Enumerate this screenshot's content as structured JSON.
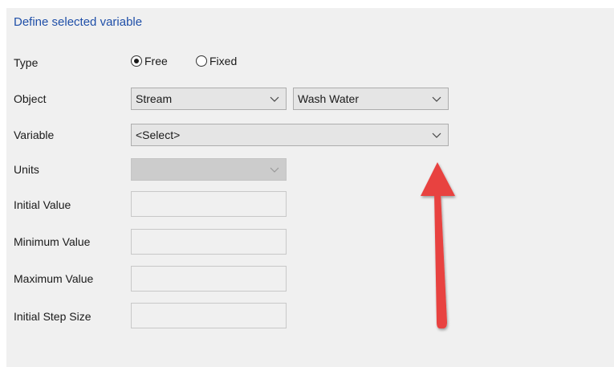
{
  "title": "Define selected variable",
  "rows": {
    "type": {
      "label": "Type",
      "options": [
        {
          "label": "Free",
          "checked": true
        },
        {
          "label": "Fixed",
          "checked": false
        }
      ]
    },
    "object": {
      "label": "Object",
      "category_value": "Stream",
      "item_value": "Wash Water"
    },
    "variable": {
      "label": "Variable",
      "value": "<Select>"
    },
    "units": {
      "label": "Units",
      "value": ""
    },
    "initial_value": {
      "label": "Initial Value",
      "value": ""
    },
    "minimum_value": {
      "label": "Minimum Value",
      "value": ""
    },
    "maximum_value": {
      "label": "Maximum Value",
      "value": ""
    },
    "initial_step_size": {
      "label": "Initial Step Size",
      "value": ""
    }
  },
  "colors": {
    "title": "#1f4fa8",
    "arrow": "#e8423f"
  }
}
